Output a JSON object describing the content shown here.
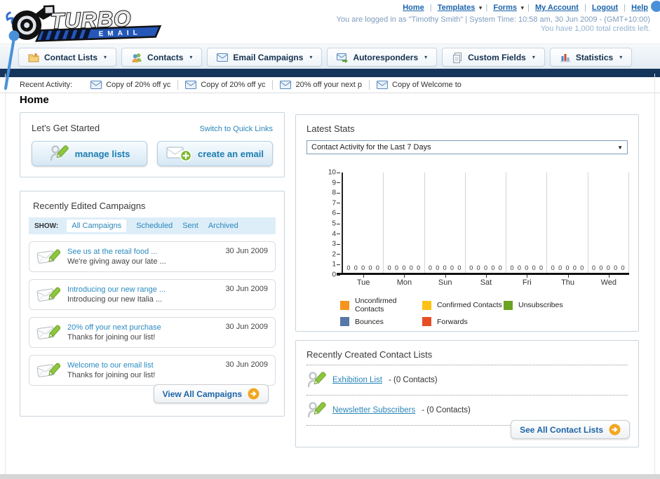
{
  "colors": {
    "link_blue": "#1b64ad",
    "light_link": "#2a86b8",
    "dark_bar": "#15355a",
    "button_text": "#1c7db2",
    "go_circle_orange": "#f2a71f",
    "annotation_blue": "#4a90d9"
  },
  "header": {
    "logo_title": "TURBO",
    "logo_subtitle": "E M A I L",
    "nav_links": [
      {
        "label": "Home",
        "dropdown": false
      },
      {
        "label": "Templates",
        "dropdown": true
      },
      {
        "label": "Forms",
        "dropdown": true
      },
      {
        "label": "My Account",
        "dropdown": false
      },
      {
        "label": "Logout",
        "dropdown": false
      },
      {
        "label": "Help",
        "dropdown": false
      }
    ],
    "login_info": "You are logged in as \"Timothy Smith\" | System Time: 10:58 am, 30 Jun 2009 - (GMT+10:00)",
    "credits_info": "You have 1,000 total credits left."
  },
  "nav_tabs": [
    {
      "label": "Contact Lists",
      "icon": "folder-icon"
    },
    {
      "label": "Contacts",
      "icon": "contacts-icon"
    },
    {
      "label": "Email Campaigns",
      "icon": "envelope-icon"
    },
    {
      "label": "Autoresponders",
      "icon": "autoresponder-icon"
    },
    {
      "label": "Custom Fields",
      "icon": "custom-fields-icon"
    },
    {
      "label": "Statistics",
      "icon": "statistics-icon"
    }
  ],
  "recent_activity": {
    "label": "Recent Activity:",
    "items": [
      {
        "label": "Copy of 20% off yc",
        "icon": "envelope-icon"
      },
      {
        "label": "Copy of 20% off yc",
        "icon": "envelope-icon"
      },
      {
        "label": "20% off your next p",
        "icon": "envelope-icon"
      },
      {
        "label": "Copy of Welcome to",
        "icon": "envelope-icon"
      }
    ]
  },
  "page_title": "Home",
  "get_started": {
    "title": "Let's Get Started",
    "switch_link": "Switch to Quick Links",
    "buttons": [
      {
        "label": "manage lists",
        "icon": "person-pencil-icon"
      },
      {
        "label": "create an email",
        "icon": "envelope-plus-icon"
      }
    ]
  },
  "campaigns_panel": {
    "title": "Recently Edited Campaigns",
    "show_label": "SHOW:",
    "filters": [
      "All Campaigns",
      "Scheduled",
      "Sent",
      "Archived"
    ],
    "active_filter": "All Campaigns",
    "items": [
      {
        "title": "See us at the retail food ...",
        "subtitle": "We're giving away our late ...",
        "date": "30 Jun 2009",
        "icon": "envelope-pencil-icon"
      },
      {
        "title": "Introducing our new range ...",
        "subtitle": "Introducing our new Italia ...",
        "date": "30 Jun 2009",
        "icon": "envelope-pencil-icon"
      },
      {
        "title": "20% off your next purchase",
        "subtitle": "Thanks for joining our list!",
        "date": "30 Jun 2009",
        "icon": "envelope-pencil-icon"
      },
      {
        "title": "Welcome to our email list",
        "subtitle": "Thanks for joining our list!",
        "date": "30 Jun 2009",
        "icon": "envelope-pencil-icon"
      }
    ],
    "view_all_label": "View All Campaigns"
  },
  "stats_panel": {
    "title": "Latest Stats",
    "selected_option": "Contact Activity for the Last 7 Days"
  },
  "chart_data": {
    "type": "bar",
    "title": "Contact Activity for the Last 7 Days",
    "categories": [
      "Tue",
      "Mon",
      "Sun",
      "Sat",
      "Fri",
      "Thu",
      "Wed"
    ],
    "series": [
      {
        "name": "Unconfirmed Contacts",
        "color": "#f7941e",
        "values": [
          0,
          0,
          0,
          0,
          0,
          0,
          0
        ]
      },
      {
        "name": "Confirmed Contacts",
        "color": "#fdc214",
        "values": [
          0,
          0,
          0,
          0,
          0,
          0,
          0
        ]
      },
      {
        "name": "Unsubscribes",
        "color": "#6ba322",
        "values": [
          0,
          0,
          0,
          0,
          0,
          0,
          0
        ]
      },
      {
        "name": "Bounces",
        "color": "#5878a8",
        "values": [
          0,
          0,
          0,
          0,
          0,
          0,
          0
        ]
      },
      {
        "name": "Forwards",
        "color": "#e64f26",
        "values": [
          0,
          0,
          0,
          0,
          0,
          0,
          0
        ]
      }
    ],
    "ylim": [
      0,
      10
    ],
    "yticks": [
      0,
      1,
      2,
      3,
      4,
      5,
      6,
      7,
      8,
      9,
      10
    ],
    "grid": "vertical-between-groups",
    "legend_position": "bottom",
    "data_labels": "zeros shown above baseline for every series in every group"
  },
  "contact_lists_panel": {
    "title": "Recently Created Contact Lists",
    "items": [
      {
        "name": "Exhibition List",
        "suffix": " - (0 Contacts)",
        "icon": "person-pencil-icon"
      },
      {
        "name": "Newsletter Subscribers",
        "suffix": " - (0 Contacts)",
        "icon": "person-pencil-icon"
      }
    ],
    "see_all_label": "See All Contact Lists"
  }
}
